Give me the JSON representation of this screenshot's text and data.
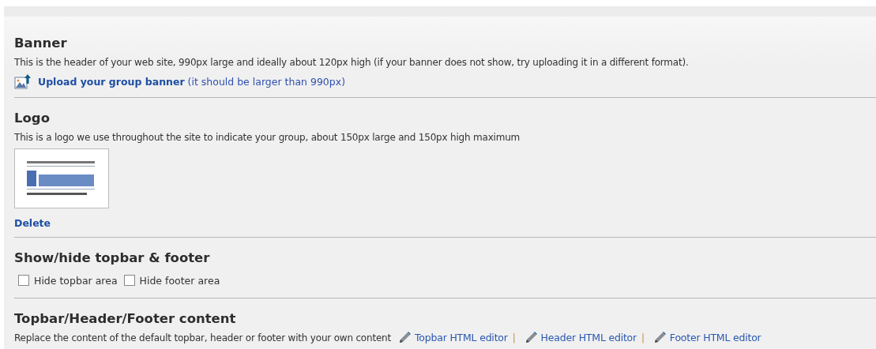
{
  "sections": [
    {
      "kind": "banner",
      "title": "Banner",
      "description": "This is the header of your web site, 990px large and ideally about 120px high (if your banner does not show, try uploading it in a different format).",
      "upload_link": "Upload your group banner",
      "upload_note": "(it should be larger than 990px)"
    },
    {
      "kind": "logo",
      "title": "Logo",
      "description": "This is a logo we use throughout the site to indicate your group, about 150px large and 150px high maximum",
      "delete_link": "Delete"
    },
    {
      "kind": "toggles",
      "title": "Show/hide topbar & footer",
      "options": [
        {
          "label": "Hide topbar area",
          "checked": false
        },
        {
          "label": "Hide footer area",
          "checked": false
        }
      ]
    },
    {
      "kind": "editors",
      "title": "Topbar/Header/Footer content",
      "description": "Replace the content of the default topbar, header or footer with your own content",
      "links": [
        "Topbar HTML editor",
        "Header HTML editor",
        "Footer HTML editor"
      ],
      "separator": "|"
    }
  ]
}
